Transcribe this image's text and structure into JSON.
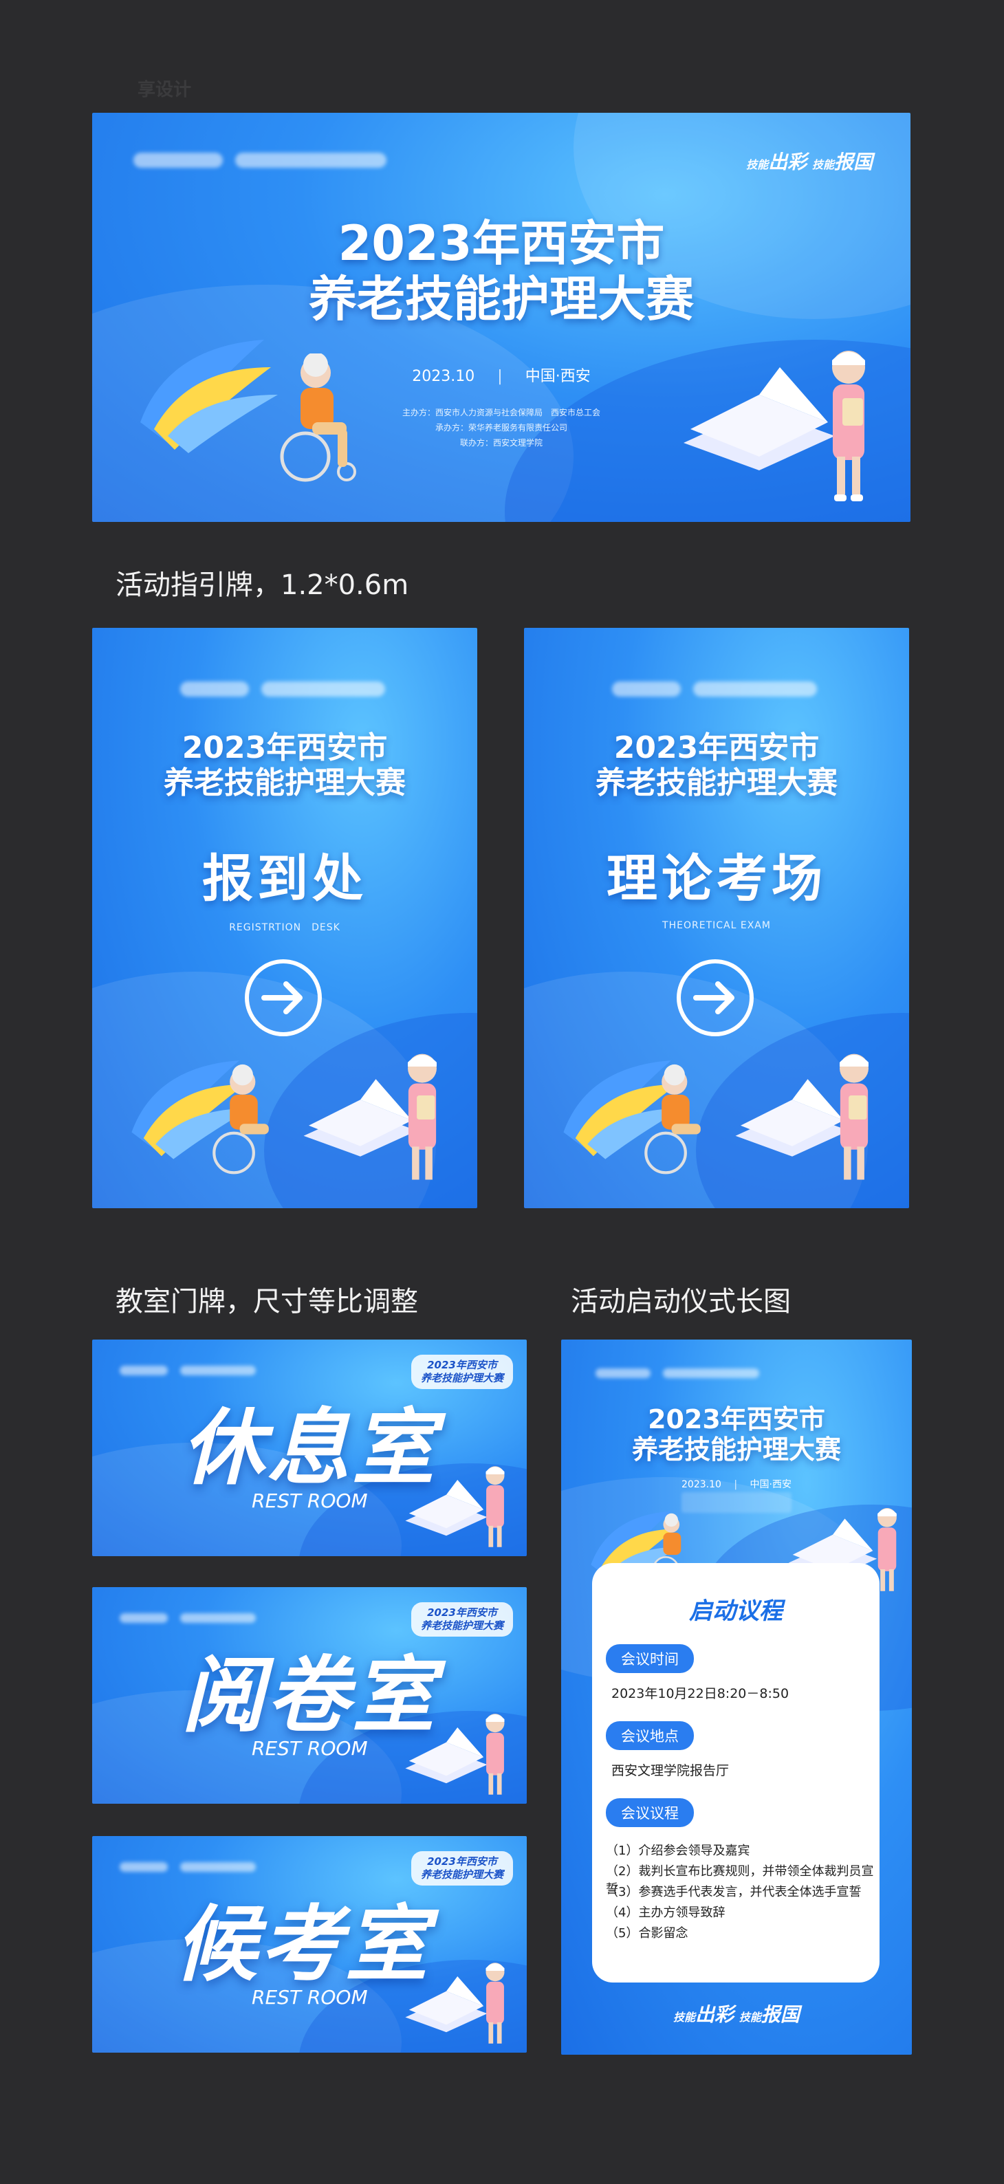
{
  "main_banner": {
    "slogan_1": "技能",
    "slogan_2": "出彩",
    "slogan_3": "技能",
    "slogan_4": "报国",
    "title_line1": "2023年西安市",
    "title_line2": "养老技能护理大赛",
    "date": "2023.10",
    "separator": "|",
    "location": "中国·西安",
    "host": "主办方：西安市人力资源与社会保障局　西安市总工会",
    "organizer": "承办方：荣华养老服务有限责任公司",
    "co_organizer": "联办方：西安文理学院"
  },
  "captions": {
    "guide_sign": "活动指引牌，1.2*0.6m",
    "door_sign": "教室门牌，尺寸等比调整",
    "ceremony": "活动启动仪式长图"
  },
  "guide_signs": [
    {
      "title_line1": "2023年西安市",
      "title_line2": "养老技能护理大赛",
      "sign": "报到处",
      "sign_en": "REGISTRTION　DESK"
    },
    {
      "title_line1": "2023年西安市",
      "title_line2": "养老技能护理大赛",
      "sign": "理论考场",
      "sign_en": "THEORETICAL EXAM"
    }
  ],
  "door_signs": [
    {
      "title": "休息室",
      "en": "REST ROOM",
      "mini_line1": "2023年西安市",
      "mini_line2": "养老技能护理大赛"
    },
    {
      "title": "阅卷室",
      "en": "REST ROOM",
      "mini_line1": "2023年西安市",
      "mini_line2": "养老技能护理大赛"
    },
    {
      "title": "候考室",
      "en": "REST ROOM",
      "mini_line1": "2023年西安市",
      "mini_line2": "养老技能护理大赛"
    }
  ],
  "ceremony": {
    "title_line1": "2023年西安市",
    "title_line2": "养老技能护理大赛",
    "date": "2023.10",
    "separator": "|",
    "location": "中国·西安",
    "agenda_title": "启动议程",
    "time_label": "会议时间",
    "time_value": "2023年10月22日8:20－8:50",
    "place_label": "会议地点",
    "place_value": "西安文理学院报告厅",
    "agenda_label": "会议议程",
    "items": [
      "（1）介绍参会领导及嘉宾",
      "（2）裁判长宣布比赛规则，并带领全体裁判员宣誓",
      "（3）参赛选手代表发言，并代表全体选手宣誓",
      "（4）主办方领导致辞",
      "（5）合影留念"
    ],
    "slogan_1": "技能",
    "slogan_2": "出彩",
    "slogan_3": "技能",
    "slogan_4": "报国"
  },
  "colors": {
    "background": "#2b2b2d",
    "panel_blue": "#2e8ff5",
    "accent_blue": "#2a7df0",
    "text_white": "#ffffff"
  },
  "watermark": "享设计"
}
